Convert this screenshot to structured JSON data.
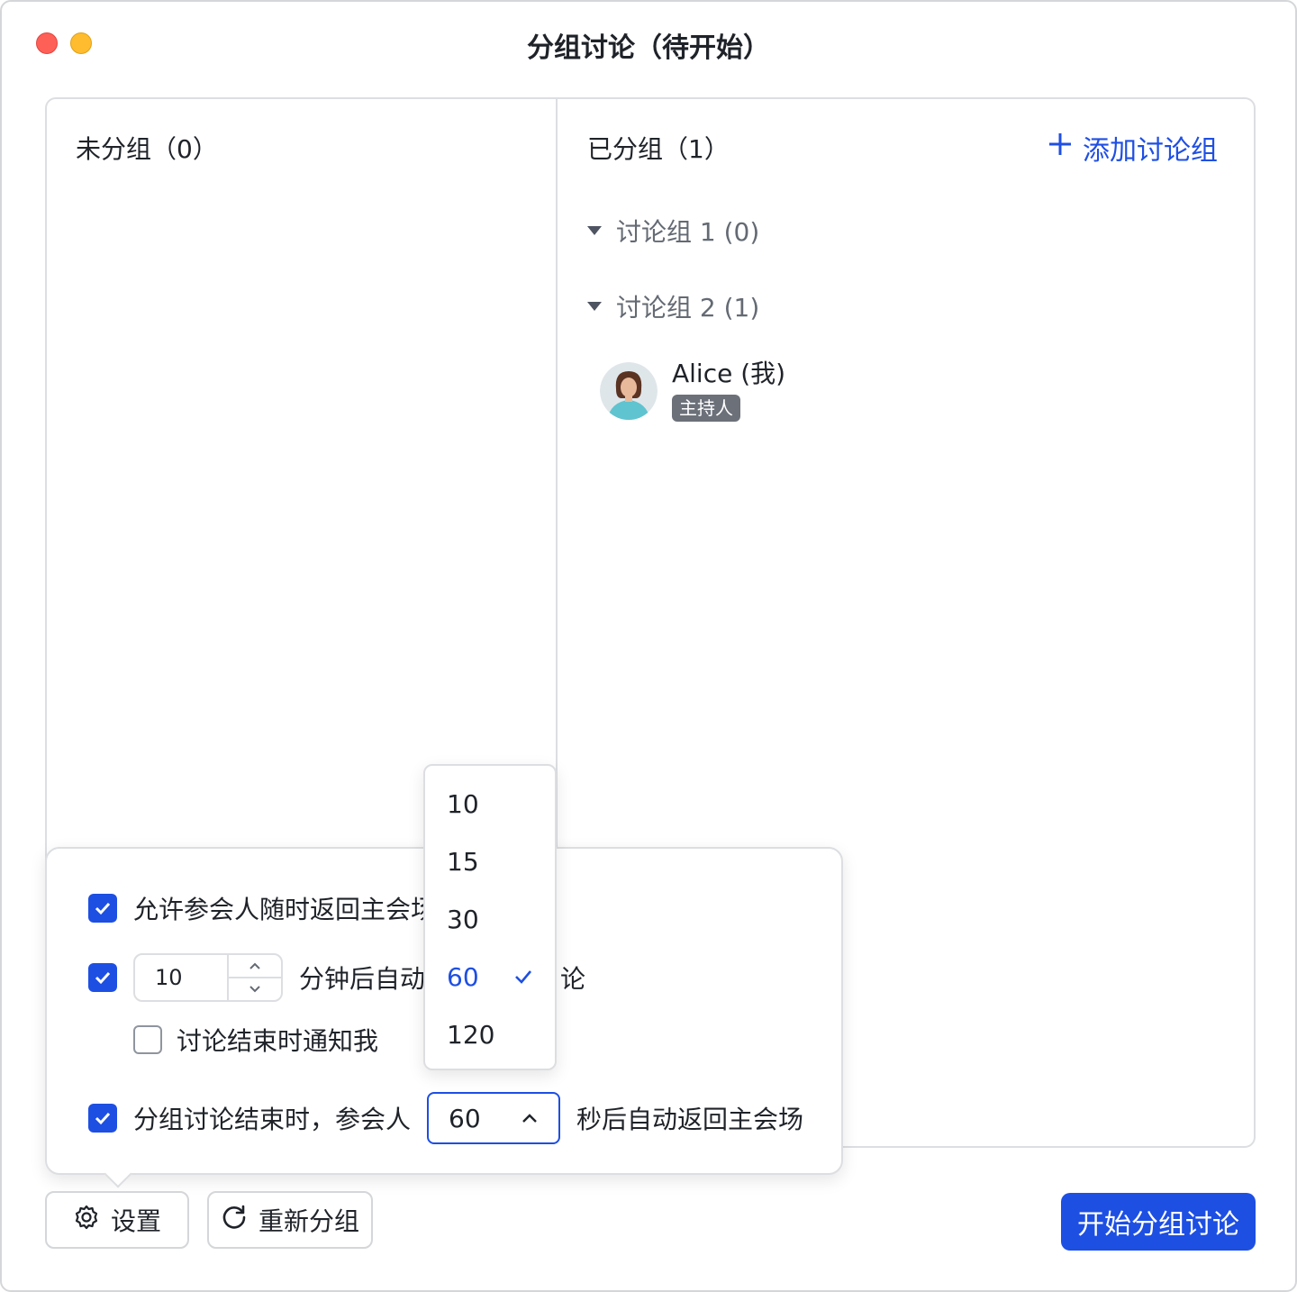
{
  "window": {
    "title": "分组讨论（待开始）"
  },
  "left_column": {
    "title": "未分组（0）"
  },
  "right_column": {
    "title": "已分组（1）",
    "add_group_label": "添加讨论组",
    "groups": [
      {
        "label": "讨论组 1 (0)"
      },
      {
        "label": "讨论组 2 (1)"
      }
    ],
    "member": {
      "name": "Alice (我)",
      "role_badge": "主持人"
    }
  },
  "settings": {
    "allow_return": {
      "checked": true,
      "label": "允许参会人随时返回主会场"
    },
    "auto_end": {
      "checked": true,
      "minutes_value": "10",
      "label_after": "分钟后自动",
      "label_tail": "论"
    },
    "notify_me": {
      "checked": false,
      "label": "讨论结束时通知我"
    },
    "auto_return": {
      "checked": true,
      "label_before": "分组讨论结束时，参会人",
      "selected_seconds": "60",
      "label_after": "秒后自动返回主会场"
    }
  },
  "dropdown": {
    "options": [
      "10",
      "15",
      "30",
      "60",
      "120"
    ],
    "selected": "60"
  },
  "buttons": {
    "settings_label": "设置",
    "regroup_label": "重新分组",
    "start_label": "开始分组讨论"
  },
  "colors": {
    "accent": "#1d4fe3",
    "close": "#fe5f57",
    "minimize": "#febc2e",
    "badge": "#6b7079"
  }
}
